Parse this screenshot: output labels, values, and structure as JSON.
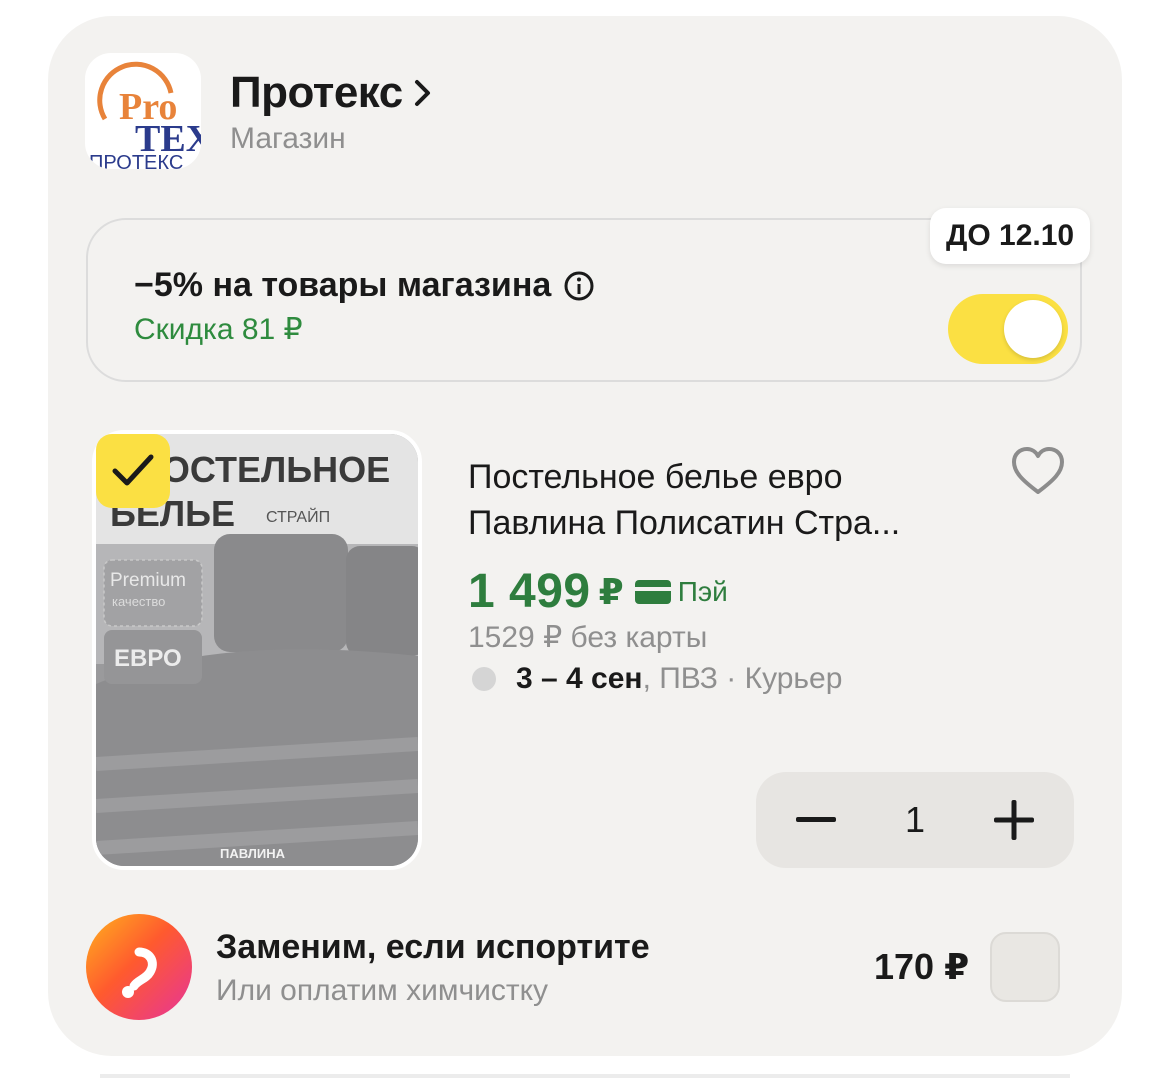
{
  "store": {
    "name": "Протекс",
    "type": "Магазин",
    "logo_text_top": "Pro",
    "logo_text_mid": "TEX",
    "logo_text_bottom": "ПРОТЕКС"
  },
  "promo": {
    "title": "−5% на товары магазина",
    "discount": "Скидка 81 ₽",
    "deadline": "ДО 12.10",
    "enabled": true
  },
  "product": {
    "selected": true,
    "title": "Постельное белье евро Павлина Полисатин Стра...",
    "price": "1 499",
    "currency": "₽",
    "pay_label": "Пэй",
    "price_without_card": "1529 ₽  без карты",
    "delivery_date": "3 – 4 сен",
    "delivery_methods": ", ПВЗ · Курьер",
    "quantity": "1",
    "image_text": {
      "line1": "ПОСТЕЛЬНОЕ",
      "line2": "БЕЛЬЕ",
      "stripe": "СТРАЙП",
      "premium": "Premium",
      "quality": "качество",
      "size": "ЕВРО",
      "brand": "ПАВЛИНА"
    }
  },
  "insurance": {
    "title": "Заменим, если испортите",
    "subtitle": "Или оплатим химчистку",
    "price": "170 ₽",
    "checked": false
  },
  "colors": {
    "accent_yellow": "#fbe043",
    "price_green": "#2e7d3e",
    "discount_green": "#2e8b3e",
    "muted": "#8f8f8f"
  }
}
